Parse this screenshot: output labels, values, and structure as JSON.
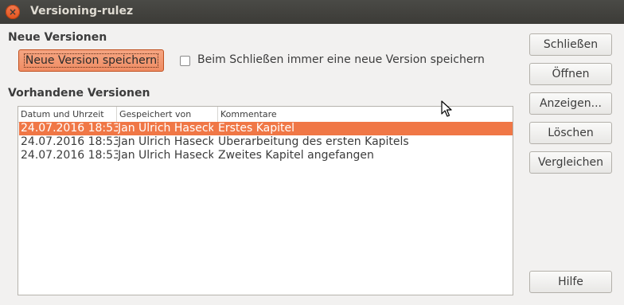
{
  "window": {
    "title": "Versioning-rulez",
    "close_symbol": "×"
  },
  "new_versions": {
    "heading": "Neue Versionen",
    "save_button": "Neue Version speichern",
    "checkbox_label": "Beim Schließen immer eine neue Version speichern",
    "checkbox_checked": false
  },
  "existing": {
    "heading": "Vorhandene Versionen",
    "columns": [
      "Datum und Uhrzeit",
      "Gespeichert von",
      "Kommentare"
    ],
    "rows": [
      {
        "date": "24.07.2016 18:53",
        "author": "Jan Ulrich Haseck",
        "comment": "Erstes Kapitel",
        "selected": true
      },
      {
        "date": "24.07.2016 18:53",
        "author": "Jan Ulrich Haseck",
        "comment": "Überarbeitung des ersten Kapitels",
        "selected": false
      },
      {
        "date": "24.07.2016 18:53",
        "author": "Jan Ulrich Haseck",
        "comment": "Zweites Kapitel angefangen",
        "selected": false
      }
    ]
  },
  "buttons": {
    "close": "Schließen",
    "open": "Öffnen",
    "show": "Anzeigen...",
    "delete": "Löschen",
    "compare": "Vergleichen",
    "help": "Hilfe"
  },
  "colors": {
    "accent": "#f07746",
    "titlebar": "#3c3b37"
  }
}
